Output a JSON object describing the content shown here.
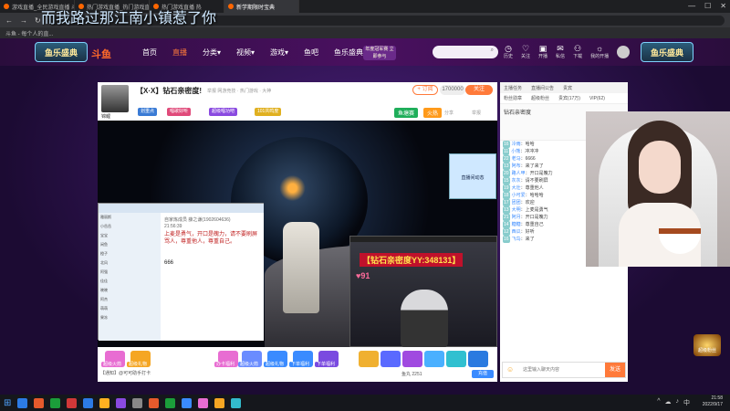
{
  "browser": {
    "tabs": [
      {
        "label": "游戏直播_全民游戏直播 斗鱼",
        "active": false
      },
      {
        "label": "热门游戏直播_热门游戏直播 斗",
        "active": false
      },
      {
        "label": "热门游戏直播 热",
        "active": false
      },
      {
        "label": "新学期限时宝典",
        "active": true
      }
    ],
    "window_controls": [
      "—",
      "☐",
      "✕"
    ],
    "nav_icons": [
      "←",
      "→",
      "↻"
    ],
    "bookmark": "斗鱼 - 每个人的直..."
  },
  "overlay_caption": "而我路过那江南小镇惹了你",
  "site": {
    "event_logo": "鱼乐盛典",
    "brand": "斗鱼",
    "nav": [
      {
        "label": "首页",
        "active": false
      },
      {
        "label": "直播",
        "active": true
      },
      {
        "label": "分类",
        "active": false,
        "dropdown": true
      },
      {
        "label": "视频",
        "active": false,
        "dropdown": true
      },
      {
        "label": "游戏",
        "active": false,
        "dropdown": true
      },
      {
        "label": "鱼吧",
        "active": false
      },
      {
        "label": "鱼乐盛典",
        "active": false
      }
    ],
    "promo": "年度冠军赛 立即参与",
    "search_placeholder": "",
    "user_menu": [
      {
        "icon": "◷",
        "label": "历史"
      },
      {
        "icon": "♡",
        "label": "关注"
      },
      {
        "icon": "▣",
        "label": "开播"
      },
      {
        "icon": "✉",
        "label": "私信"
      },
      {
        "icon": "⚇",
        "label": "下载"
      },
      {
        "icon": "☼",
        "label": "我的开播"
      }
    ]
  },
  "room": {
    "title": "【X·X】钻石亲密度!",
    "meta": "举报  网游竞技 · 热门游戏 · 大神",
    "anchor_name": "锦鲤",
    "tags": [
      "划重点",
      "唱歌好听",
      "超级唱功吧",
      "101共鸣度"
    ],
    "tag_colors": [
      "#3a7bd5",
      "#e04a7a",
      "#8a4ae0",
      "#e0b020"
    ],
    "subscribe_label": "+ 订阅",
    "follow_count": "1700000",
    "follow_label": "关注",
    "share": "分享",
    "report": "举报",
    "cam_caption": "【钻石亲密度YY:348131】",
    "cam_count": "91",
    "map_widget": "直播间动态",
    "game_label": "鱼塘赛",
    "fire_label": "火热"
  },
  "desktop_chat": {
    "header": "自家炼成员  薛之谦(1902604636)",
    "time": "21:56:39",
    "message": "上麦是勇气，开口是魄力，请不要刷屏骂人，尊重他人，尊重自己。",
    "reply1": "666",
    "list": [
      "雅丽斯",
      "小岳岳",
      "宝宝",
      "闲鱼",
      "橙子",
      "北风",
      "阿强",
      "佳佳",
      "晓晓",
      "阿杰",
      "萌萌",
      "果冻"
    ]
  },
  "gifts": [
    {
      "label": "超级火箭",
      "color": "#e86dd2"
    },
    {
      "label": "超级礼物",
      "color": "#f5a623"
    },
    {
      "label": "办卡福利",
      "color": "#e86dd2"
    },
    {
      "label": "超级火箭",
      "color": "#6a8cff"
    },
    {
      "label": "超级礼物",
      "color": "#3a8bff"
    },
    {
      "label": "下单福利",
      "color": "#3a8bff"
    },
    {
      "label": "下单福利",
      "color": "#7a4ae0"
    }
  ],
  "gift_footer": "【通知】@可可助手打卡",
  "gift_info": "鱼丸 2251 ",
  "recharge": "充值",
  "chat": {
    "tabs": [
      "主播任务",
      "直播间公告",
      "贵宾"
    ],
    "tabs2": [
      "粉丝勋章",
      "超级粉丝",
      "贵宾(17万)",
      "VIP(62)"
    ],
    "intro_title": "钻石亲密度",
    "messages": [
      {
        "lv": "16",
        "name": "冷雨",
        "text": "：哈哈"
      },
      {
        "lv": "11",
        "name": "小熊",
        "text": "：冲冲冲"
      },
      {
        "lv": "22",
        "name": "老马",
        "text": "：6666"
      },
      {
        "lv": "13",
        "name": "阿布",
        "text": "：来了来了"
      },
      {
        "lv": "20",
        "name": "路人甲",
        "text": "：开口是魄力"
      },
      {
        "lv": "15",
        "name": "灰灰",
        "text": "：请不要刷屏"
      },
      {
        "lv": "19",
        "name": "大壮",
        "text": "：尊重他人"
      },
      {
        "lv": "18",
        "name": "小可爱",
        "text": "：哈哈哈"
      },
      {
        "lv": "17",
        "name": "团团",
        "text": "：欢迎"
      },
      {
        "lv": "13",
        "name": "大明",
        "text": "：上麦是勇气"
      },
      {
        "lv": "21",
        "name": "阿月",
        "text": "：开口是魄力"
      },
      {
        "lv": "14",
        "name": "糖糖",
        "text": "：尊重自己"
      },
      {
        "lv": "12",
        "name": "西瓜",
        "text": "：好听"
      },
      {
        "lv": "16",
        "name": "飞鸟",
        "text": "：来了"
      }
    ],
    "input_placeholder": "这里输入聊天内容",
    "send_label": "发送"
  },
  "right_badge": "超级粉丝",
  "taskbar": {
    "apps": [
      "#2c7be5",
      "#e65a2c",
      "#1b9d3a",
      "#d13838",
      "#2c7be5",
      "#ffb020",
      "#8a4ae0",
      "#888",
      "#e65a2c",
      "#1b9d3a",
      "#3a8bff",
      "#e86dd2",
      "#f5a623",
      "#33bbcc"
    ],
    "time": "21:58",
    "date": "2022/9/17",
    "tray": [
      "^",
      "☁",
      "♪",
      "中"
    ]
  }
}
